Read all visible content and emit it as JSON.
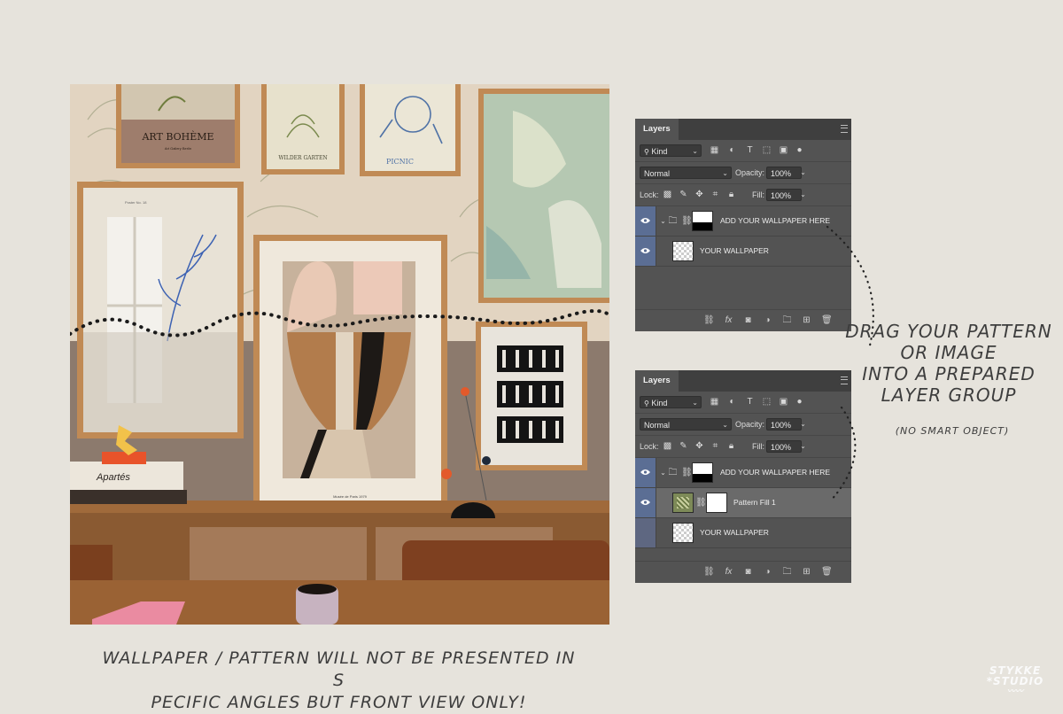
{
  "photo": {
    "print_art_boheme_title": "ART BOHÈME",
    "print_art_boheme_sub": "Art Gallery Berlin",
    "print_garden_title": "WILDER GARTEN",
    "print_picnic_title": "PICNIC",
    "print_poster_no": "Poster No. 18",
    "print_vase_caption": "Musée de Paris 1979",
    "book_spine": "Apartés"
  },
  "layers_panel_1": {
    "tab_label": "Layers",
    "filter_kind": "Kind",
    "blend_mode": "Normal",
    "opacity_label": "Opacity:",
    "opacity_value": "100%",
    "lock_label": "Lock:",
    "fill_label": "Fill:",
    "fill_value": "100%",
    "layers": [
      {
        "name": "ADD YOUR WALLPAPER HERE",
        "type": "group",
        "visible": true
      },
      {
        "name": "YOUR WALLPAPER",
        "type": "layer",
        "visible": true
      }
    ]
  },
  "layers_panel_2": {
    "tab_label": "Layers",
    "filter_kind": "Kind",
    "blend_mode": "Normal",
    "opacity_label": "Opacity:",
    "opacity_value": "100%",
    "lock_label": "Lock:",
    "fill_label": "Fill:",
    "fill_value": "100%",
    "layers": [
      {
        "name": "ADD YOUR WALLPAPER HERE",
        "type": "group",
        "visible": true
      },
      {
        "name": "Pattern Fill 1",
        "type": "fill",
        "visible": true,
        "selected": true
      },
      {
        "name": "YOUR WALLPAPER",
        "type": "layer",
        "visible": false
      }
    ]
  },
  "annotations": {
    "instruction_line1": "DRAG YOUR PATTERN",
    "instruction_line2": "OR IMAGE",
    "instruction_line3": "INTO A PREPARED",
    "instruction_line4": "LAYER GROUP",
    "no_smart_object": "(NO SMART OBJECT)",
    "caption_line1": "WALLPAPER / PATTERN WILL NOT BE PRESENTED IN S",
    "caption_line2": "PECIFIC ANGLES BUT FRONT VIEW ONLY!"
  },
  "logo": {
    "line1": "STYKKE",
    "line2": "*STUDIO"
  },
  "colors": {
    "background": "#e6e3dc",
    "panel": "#535353",
    "eye_column": "#5b6e94"
  }
}
